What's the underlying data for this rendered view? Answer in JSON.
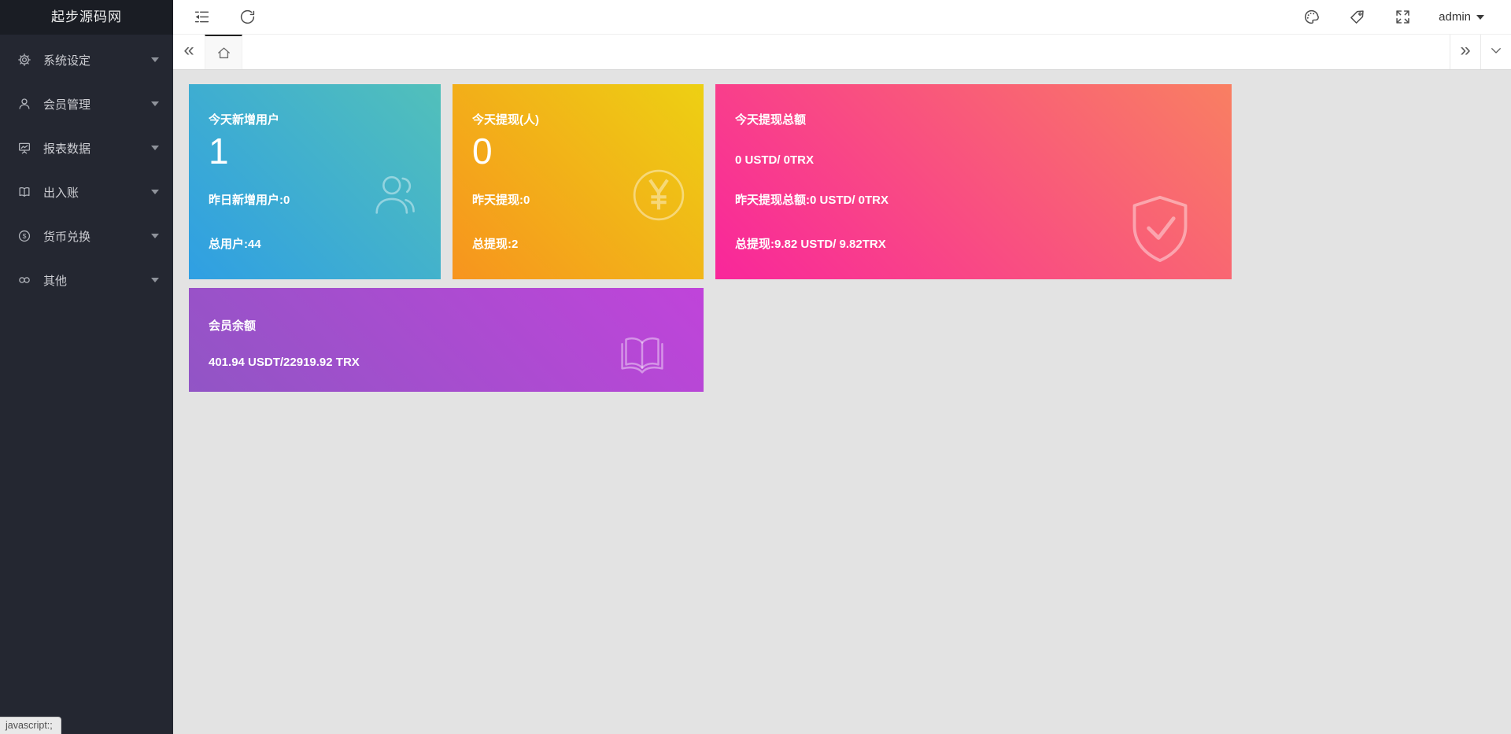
{
  "app": {
    "title": "起步源码网"
  },
  "sidebar": {
    "items": [
      {
        "icon": "gear-icon",
        "label": "系统设定"
      },
      {
        "icon": "user-icon",
        "label": "会员管理"
      },
      {
        "icon": "chart-board-icon",
        "label": "报表数据"
      },
      {
        "icon": "ledger-book-icon",
        "label": "出入账"
      },
      {
        "icon": "dollar-circle-icon",
        "label": "货币兑换"
      },
      {
        "icon": "link-icon",
        "label": "其他"
      }
    ]
  },
  "header": {
    "left_icons": [
      "collapse-menu-icon",
      "refresh-icon"
    ],
    "right_icons": [
      "palette-icon",
      "tag-icon",
      "fullscreen-icon"
    ],
    "user_label": "admin"
  },
  "tabbar": {
    "scroll_left_glyph": "«",
    "scroll_right_glyph": "»",
    "home_tab_icon": "home-icon",
    "collapse_tabs_icon": "chevron-down-icon"
  },
  "cards": [
    {
      "title": "今天新增用户",
      "big_value": "1",
      "line2": "昨日新增用户:0",
      "line3": "总用户:44",
      "icon": "users-icon",
      "gradient": [
        "#2f9fe3",
        "#52c0ba"
      ]
    },
    {
      "title": "今天提现(人)",
      "big_value": "0",
      "line2": "昨天提现:0",
      "line3": "总提现:2",
      "icon": "yen-circle-icon",
      "gradient": [
        "#f7941e",
        "#edd013"
      ]
    },
    {
      "title": "今天提现总额",
      "value": "0 USTD/ 0TRX",
      "line2": "昨天提现总额:0 USTD/ 0TRX",
      "line3": "总提现:9.82 USTD/ 9.82TRX",
      "icon": "shield-check-icon",
      "gradient": [
        "#f9269b",
        "#f97f62"
      ]
    },
    {
      "title": "会员余额",
      "value": "401.94 USDT/22919.92 TRX",
      "icon": "open-book-icon",
      "gradient": [
        "#9155c5",
        "#c044da"
      ]
    }
  ],
  "statusbar": {
    "text": "javascript:;"
  },
  "colors": {
    "content_bg": "#e3e3e3",
    "sidebar_bg": "#242731",
    "sidebar_header_bg": "#1a1d24",
    "topbar_bg": "#ffffff",
    "active_tab_border": "#1f1f1f"
  }
}
